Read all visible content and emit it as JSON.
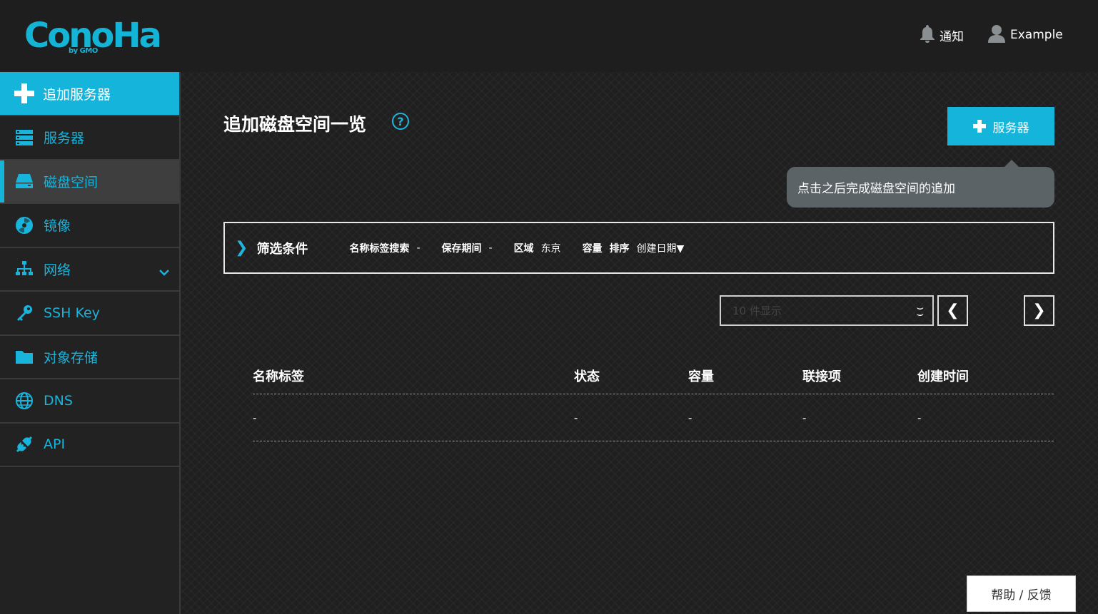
{
  "header": {
    "logo_text": "ConoHa",
    "logo_sub": "by GMO",
    "notification_label": "通知",
    "user_label": "Example"
  },
  "sidebar": {
    "add_label": "追加服务器",
    "items": [
      {
        "label": "服务器",
        "icon": "server-icon"
      },
      {
        "label": "磁盘空间",
        "icon": "disk-icon"
      },
      {
        "label": "镜像",
        "icon": "image-icon"
      },
      {
        "label": "网络",
        "icon": "network-icon"
      },
      {
        "label": "SSH Key",
        "icon": "key-icon"
      },
      {
        "label": "对象存储",
        "icon": "folder-icon"
      },
      {
        "label": "DNS",
        "icon": "globe-icon"
      },
      {
        "label": "API",
        "icon": "api-icon"
      }
    ],
    "active_index": 1
  },
  "main": {
    "title": "追加磁盘空间一览",
    "help_symbol": "?",
    "add_server_label": "服务器",
    "tooltip": "点击之后完成磁盘空间的追加",
    "filter": {
      "arrow": "❯",
      "title": "筛选条件",
      "name_search_label": "名称标签搜索",
      "name_search_value": "-",
      "retention_label": "保存期间",
      "retention_value": "-",
      "region_label": "区域",
      "region_value": "东京",
      "capacity_label": "容量",
      "sort_label": "排序",
      "sort_value": "创建日期▼"
    },
    "pager": {
      "select_value": "10 件显示",
      "prev": "❮",
      "next": "❯"
    },
    "table": {
      "headers": [
        "名称标签",
        "状态",
        "容量",
        "联接项",
        "创建时间"
      ],
      "rows": [
        [
          "-",
          "-",
          "-",
          "-",
          "-"
        ]
      ]
    },
    "help_feedback": "帮助 / 反馈"
  },
  "colors": {
    "accent": "#15b5db",
    "background": "#1f1f1f",
    "tooltip": "#5c6366"
  }
}
